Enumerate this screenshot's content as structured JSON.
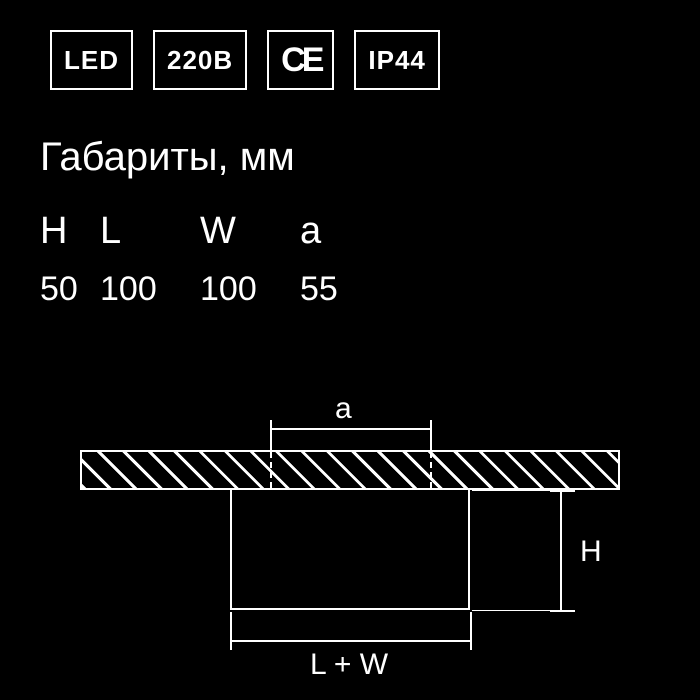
{
  "badges": {
    "led": "LED",
    "voltage": "220B",
    "ce": "CE",
    "ip": "IP44"
  },
  "title": "Габариты, мм",
  "cols": {
    "h": "H",
    "l": "L",
    "w": "W",
    "a": "a"
  },
  "vals": {
    "h": "50",
    "l": "100",
    "w": "100",
    "a": "55"
  },
  "dims": {
    "a": "a",
    "h": "H",
    "lw": "L + W"
  }
}
